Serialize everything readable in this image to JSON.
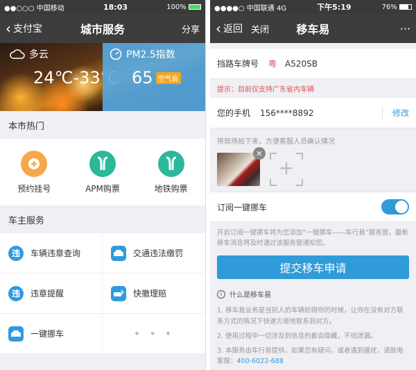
{
  "left": {
    "status": {
      "carrier": "●●○○○ 中国移动",
      "time": "18:03",
      "battery": "100%"
    },
    "nav": {
      "back_label": "支付宝",
      "title": "城市服务",
      "right_label": "分享"
    },
    "weather": {
      "condition": "多云",
      "temperature": "24℃-33℃"
    },
    "pm25": {
      "label": "PM2.5指数",
      "value": "65",
      "quality": "空气良"
    },
    "hot": {
      "header": "本市热门",
      "items": [
        {
          "label": "预约挂号",
          "icon": "plus-icon",
          "color": "#f5a84a"
        },
        {
          "label": "APM购票",
          "icon": "metro-icon",
          "color": "#2cb89a"
        },
        {
          "label": "地铁购票",
          "icon": "metro-icon",
          "color": "#2cb89a"
        }
      ]
    },
    "car": {
      "header": "车主服务",
      "items": [
        {
          "label": "车辆违章查询",
          "icon": "violation-query-icon",
          "color": "#2e9be0"
        },
        {
          "label": "交通违法缴罚",
          "icon": "car-front-icon",
          "color": "#2e9be0"
        },
        {
          "label": "违章提醒",
          "icon": "alarm-icon",
          "color": "#2e9be0"
        },
        {
          "label": "快撤理赔",
          "icon": "claim-icon",
          "color": "#2e9be0"
        },
        {
          "label": "一键挪车",
          "icon": "car-move-icon",
          "color": "#2e9be0"
        }
      ],
      "more": "• • •"
    }
  },
  "right": {
    "status": {
      "carrier": "●●●●○ 中国联通 4G",
      "time": "下午5:19",
      "battery": "76%"
    },
    "nav": {
      "back_label": "返回",
      "close_label": "关闭",
      "title": "移车易",
      "more": "···"
    },
    "plate": {
      "label": "挡路车牌号",
      "province": "粤",
      "number": "A520SB"
    },
    "tip": "提示：目前仅支持广东省内车辆",
    "phone": {
      "label": "您的手机",
      "number": "156****8892",
      "edit": "修改"
    },
    "photo_hint": "将现场拍下来，方便客服人员确认情况",
    "subscribe": {
      "label": "订阅一键挪车",
      "on": true
    },
    "subscribe_desc": "开启订阅一键挪车将为您添加“一键挪车——车行易”服务窗，最新移车消息将及时通过该服务窗通知您。",
    "submit": "提交移车申请",
    "what_is": "什么是移车易",
    "faq": [
      "1. 移车易业务是当别人的车辆妨碍你的时候，让你在没有对方联系方式的情况下快速方便地联系到对方。",
      "2. 使用过程中一切涉及到信息的都会隐藏，不怕泄漏。",
      "3. 本服务由车行易提供，如果您有疑问，或者遇到骚扰，请致电客服："
    ],
    "hotline": "400-6022-688"
  }
}
